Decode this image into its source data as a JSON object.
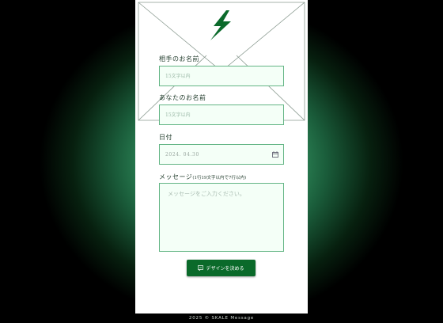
{
  "form": {
    "recipient_label": "相手のお名前",
    "recipient_placeholder": "15文字以内",
    "sender_label": "あなたのお名前",
    "sender_placeholder": "15文字以内",
    "date_label": "日付",
    "date_value": "2024. 04.30",
    "message_label": "メッセージ",
    "message_note": "(1行19文字以内で7行以内)",
    "message_placeholder": "メッセージをご入力ください。",
    "submit_label": "デザインを決める"
  },
  "footer": {
    "copyright": "2025 © SKALE Message"
  },
  "colors": {
    "accent": "#0a6a2a",
    "border": "#63b585",
    "field_bg": "#f4fff7"
  },
  "icons": [
    "lightning-bolt-icon",
    "calendar-icon",
    "edit-icon"
  ]
}
